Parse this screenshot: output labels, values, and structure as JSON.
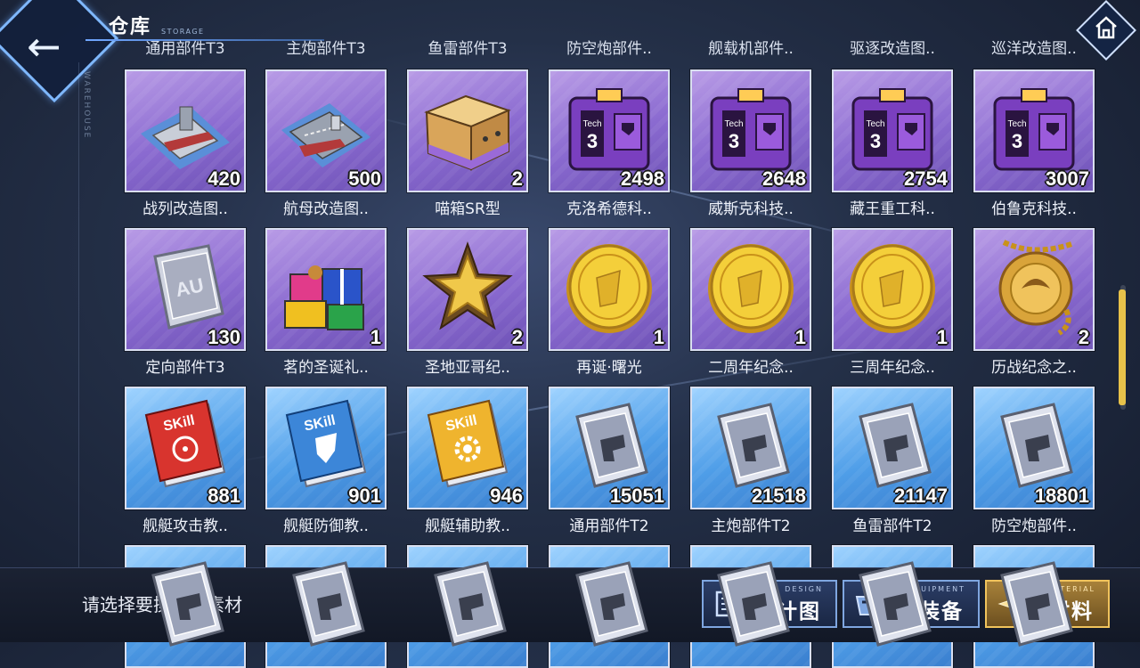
{
  "header": {
    "title": "仓库",
    "subtitle": "STORAGE",
    "side_label": "WAREHOUSE"
  },
  "top_partial_labels": [
    "通用部件T3",
    "主炮部件T3",
    "鱼雷部件T3",
    "防空炮部件..",
    "舰载机部件..",
    "驱逐改造图..",
    "巡洋改造图.."
  ],
  "rows": [
    [
      {
        "label": "战列改造图..",
        "count": "420",
        "icon": "battleship-blueprint-icon",
        "color": "purple"
      },
      {
        "label": "航母改造图..",
        "count": "500",
        "icon": "carrier-blueprint-icon",
        "color": "purple"
      },
      {
        "label": "喵箱SR型",
        "count": "2",
        "icon": "cat-box-icon",
        "color": "purple"
      },
      {
        "label": "克洛希德科..",
        "count": "2498",
        "icon": "tech-box-icon",
        "color": "purple"
      },
      {
        "label": "威斯克科技..",
        "count": "2648",
        "icon": "tech-box-icon",
        "color": "purple"
      },
      {
        "label": "藏王重工科..",
        "count": "2754",
        "icon": "tech-box-icon",
        "color": "purple"
      },
      {
        "label": "伯鲁克科技..",
        "count": "3007",
        "icon": "tech-box-icon",
        "color": "purple"
      }
    ],
    [
      {
        "label": "定向部件T3",
        "count": "130",
        "icon": "directional-part-icon",
        "color": "purple"
      },
      {
        "label": "茗的圣诞礼..",
        "count": "1",
        "icon": "gift-pile-icon",
        "color": "purple"
      },
      {
        "label": "圣地亚哥纪..",
        "count": "2",
        "icon": "star-badge-icon",
        "color": "purple"
      },
      {
        "label": "再诞·曙光",
        "count": "1",
        "icon": "gold-coin-icon",
        "color": "purple"
      },
      {
        "label": "二周年纪念..",
        "count": "1",
        "icon": "gold-coin-icon",
        "color": "purple"
      },
      {
        "label": "三周年纪念..",
        "count": "1",
        "icon": "gold-coin-icon",
        "color": "purple"
      },
      {
        "label": "历战纪念之..",
        "count": "2",
        "icon": "gold-medal-icon",
        "color": "purple"
      }
    ],
    [
      {
        "label": "舰艇攻击教..",
        "count": "881",
        "icon": "skill-book-red-icon",
        "color": "blue"
      },
      {
        "label": "舰艇防御教..",
        "count": "901",
        "icon": "skill-book-blue-icon",
        "color": "blue"
      },
      {
        "label": "舰艇辅助教..",
        "count": "946",
        "icon": "skill-book-yellow-icon",
        "color": "blue"
      },
      {
        "label": "通用部件T2",
        "count": "15051",
        "icon": "part-plate-icon",
        "color": "blue"
      },
      {
        "label": "主炮部件T2",
        "count": "21518",
        "icon": "part-plate-icon",
        "color": "blue"
      },
      {
        "label": "鱼雷部件T2",
        "count": "21147",
        "icon": "part-plate-icon",
        "color": "blue"
      },
      {
        "label": "防空炮部件..",
        "count": "18801",
        "icon": "part-plate-icon",
        "color": "blue"
      }
    ],
    [
      {
        "label": "",
        "count": "",
        "icon": "part-plate-icon",
        "color": "blue"
      },
      {
        "label": "",
        "count": "",
        "icon": "part-plate-icon",
        "color": "blue"
      },
      {
        "label": "",
        "count": "",
        "icon": "part-plate-icon",
        "color": "blue"
      },
      {
        "label": "",
        "count": "",
        "icon": "part-plate-icon",
        "color": "blue"
      },
      {
        "label": "",
        "count": "",
        "icon": "part-plate-icon",
        "color": "blue"
      },
      {
        "label": "",
        "count": "",
        "icon": "part-plate-icon",
        "color": "blue"
      },
      {
        "label": "",
        "count": "",
        "icon": "part-plate-icon",
        "color": "blue"
      }
    ]
  ],
  "footer": {
    "hint": "请选择要操作的素材",
    "tabs": [
      {
        "label": "设计图",
        "sub": "DESIGN",
        "icon": "blueprint-icon",
        "active": false
      },
      {
        "label": "装备",
        "sub": "EQUIPMENT",
        "icon": "equipment-icon",
        "active": false
      },
      {
        "label": "材料",
        "sub": "MATERIAL",
        "icon": "material-star-icon",
        "active": true
      }
    ]
  }
}
